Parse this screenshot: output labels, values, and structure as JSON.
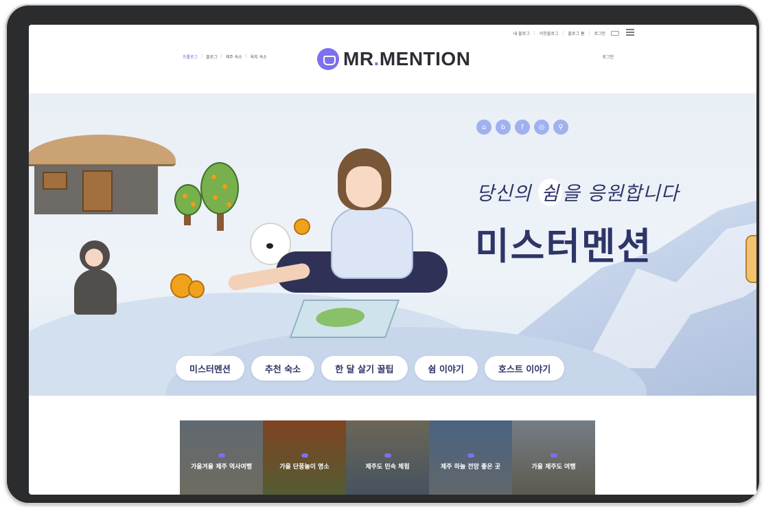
{
  "header": {
    "util_links": [
      "내 블로그",
      "이웃블로그",
      "블로그 홈",
      "로그인"
    ],
    "nav_links": [
      "프롤로그",
      "블로그",
      "제주 숙소",
      "육지 숙소"
    ],
    "login": "로그인",
    "logo_text_before": "MR",
    "logo_dot": ".",
    "logo_text_after": "MENTION"
  },
  "hero": {
    "socials": [
      {
        "icon": "home-icon",
        "glyph": "⌂"
      },
      {
        "icon": "blog-icon",
        "glyph": "b"
      },
      {
        "icon": "facebook-icon",
        "glyph": "f"
      },
      {
        "icon": "instagram-icon",
        "glyph": "◎"
      },
      {
        "icon": "location-icon",
        "glyph": "⚲"
      }
    ],
    "tagline_before": "당신의 ",
    "tagline_highlight": "쉼",
    "tagline_after": "을 응원합니다",
    "title": "미스터멘션",
    "pills": [
      "미스터멘션",
      "추천 숙소",
      "한 달 살기 꿀팁",
      "쉼 이야기",
      "호스트 이야기"
    ]
  },
  "cards": [
    {
      "title": "가을겨울 제주 역사여행",
      "colors": [
        "#7b8791",
        "#8e8a7c"
      ]
    },
    {
      "title": "가을 단풍놀이 명소",
      "colors": [
        "#a4562c",
        "#6c7742"
      ]
    },
    {
      "title": "제주도 민속 체험",
      "colors": [
        "#8a8370",
        "#5a6b7c"
      ]
    },
    {
      "title": "제주 하늘 전망 좋은 곳",
      "colors": [
        "#5f7fa6",
        "#7d8489"
      ]
    },
    {
      "title": "가을 제주도 여행",
      "colors": [
        "#96a1ab",
        "#787466"
      ]
    }
  ],
  "colors": {
    "accent": "#7d6ff0",
    "navy": "#2e3568"
  }
}
